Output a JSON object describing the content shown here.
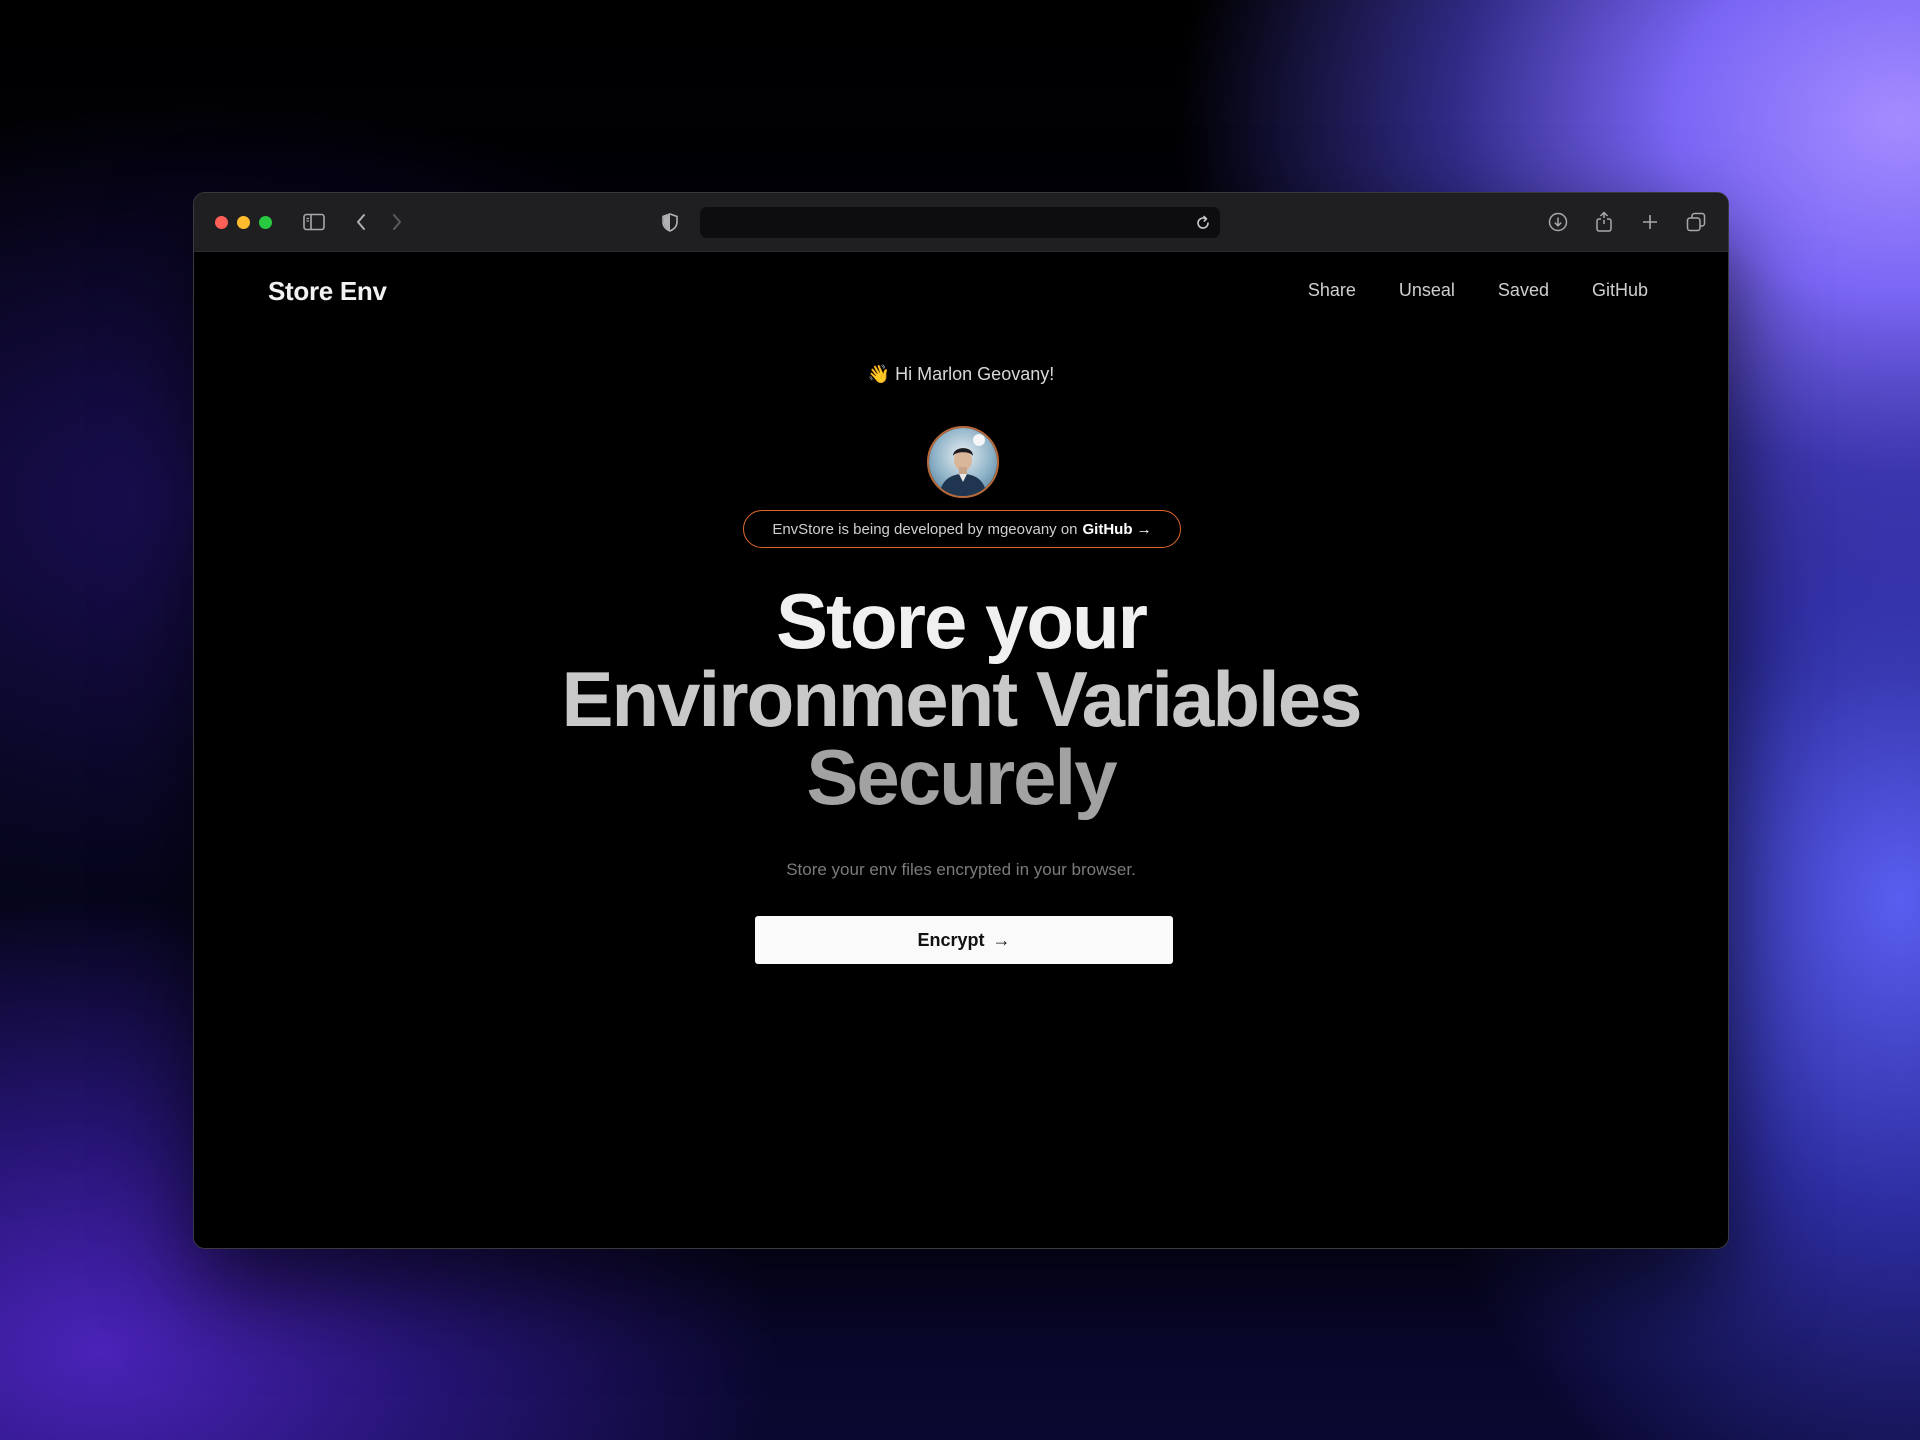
{
  "browser": {
    "address_value": "",
    "icons": [
      "sidebar-icon",
      "back-icon",
      "forward-icon",
      "shield-icon",
      "reload-icon",
      "download-icon",
      "share-icon",
      "new-tab-icon",
      "tabs-overview-icon"
    ]
  },
  "header": {
    "brand": "Store Env",
    "nav": [
      "Share",
      "Unseal",
      "Saved",
      "GitHub"
    ]
  },
  "hero": {
    "greeting": "👋 Hi Marlon Geovany!",
    "badge_text": "EnvStore is being developed by mgeovany on",
    "badge_link": "GitHub →",
    "title_line1": "Store your",
    "title_line2": "Environment Variables",
    "title_line3": "Securely",
    "subtitle": "Store your env files encrypted in your browser.",
    "cta_label": "Encrypt",
    "cta_arrow": "→"
  },
  "colors": {
    "badge_border": "#e0672a",
    "page_bg": "#000000",
    "cta_bg": "#fafafa"
  }
}
